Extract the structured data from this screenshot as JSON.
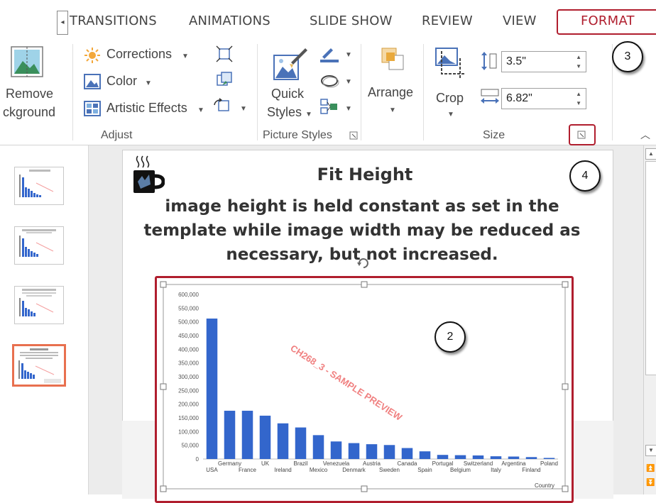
{
  "tabs": {
    "scroll_glyph": "◂",
    "items": [
      "TRANSITIONS",
      "ANIMATIONS",
      "SLIDE SHOW",
      "REVIEW",
      "VIEW",
      "FORMAT"
    ],
    "active": "FORMAT"
  },
  "ribbon": {
    "remove_bg": {
      "line1": "Remove",
      "line2": "ckground"
    },
    "adjust": {
      "corrections": "Corrections",
      "color": "Color",
      "artistic": "Artistic Effects",
      "group_label": "Adjust"
    },
    "picture_styles": {
      "quick": "Quick",
      "styles": "Styles",
      "group_label": "Picture Styles"
    },
    "arrange": {
      "label": "Arrange"
    },
    "size": {
      "crop": "Crop",
      "height": "3.5\"",
      "width": "6.82\"",
      "group_label": "Size"
    }
  },
  "slide": {
    "title": "Fit Height",
    "body": [
      "image height is held constant as set in the",
      "template while image width may be reduced as",
      "necessary, but not increased."
    ]
  },
  "callouts": [
    "2",
    "3",
    "4"
  ],
  "watermark": "CH268_3 - SAMPLE PREVIEW",
  "chart_data": {
    "type": "bar",
    "categories": [
      "USA",
      "Germany",
      "France",
      "UK",
      "Ireland",
      "Brazil",
      "Mexico",
      "Venezuela",
      "Denmark",
      "Austria",
      "Sweden",
      "Canada",
      "Spain",
      "Portugal",
      "Belgium",
      "Switzerland",
      "Italy",
      "Argentina",
      "Finland",
      "Poland"
    ],
    "values": [
      512000,
      176000,
      176000,
      158000,
      130000,
      115000,
      87000,
      64000,
      58000,
      54000,
      51000,
      40000,
      28000,
      15000,
      14000,
      13000,
      10000,
      9000,
      7000,
      4000
    ],
    "yticks": [
      "0",
      "50,000",
      "100,000",
      "150,000",
      "200,000",
      "250,000",
      "300,000",
      "350,000",
      "400,000",
      "450,000",
      "500,000",
      "550,000",
      "600,000"
    ],
    "ylim": [
      0,
      600000
    ],
    "xlabel": "Country",
    "bar_color": "#3366cc"
  },
  "colors": {
    "accent_red": "#b01e2e",
    "selection_orange": "#e8704f"
  }
}
